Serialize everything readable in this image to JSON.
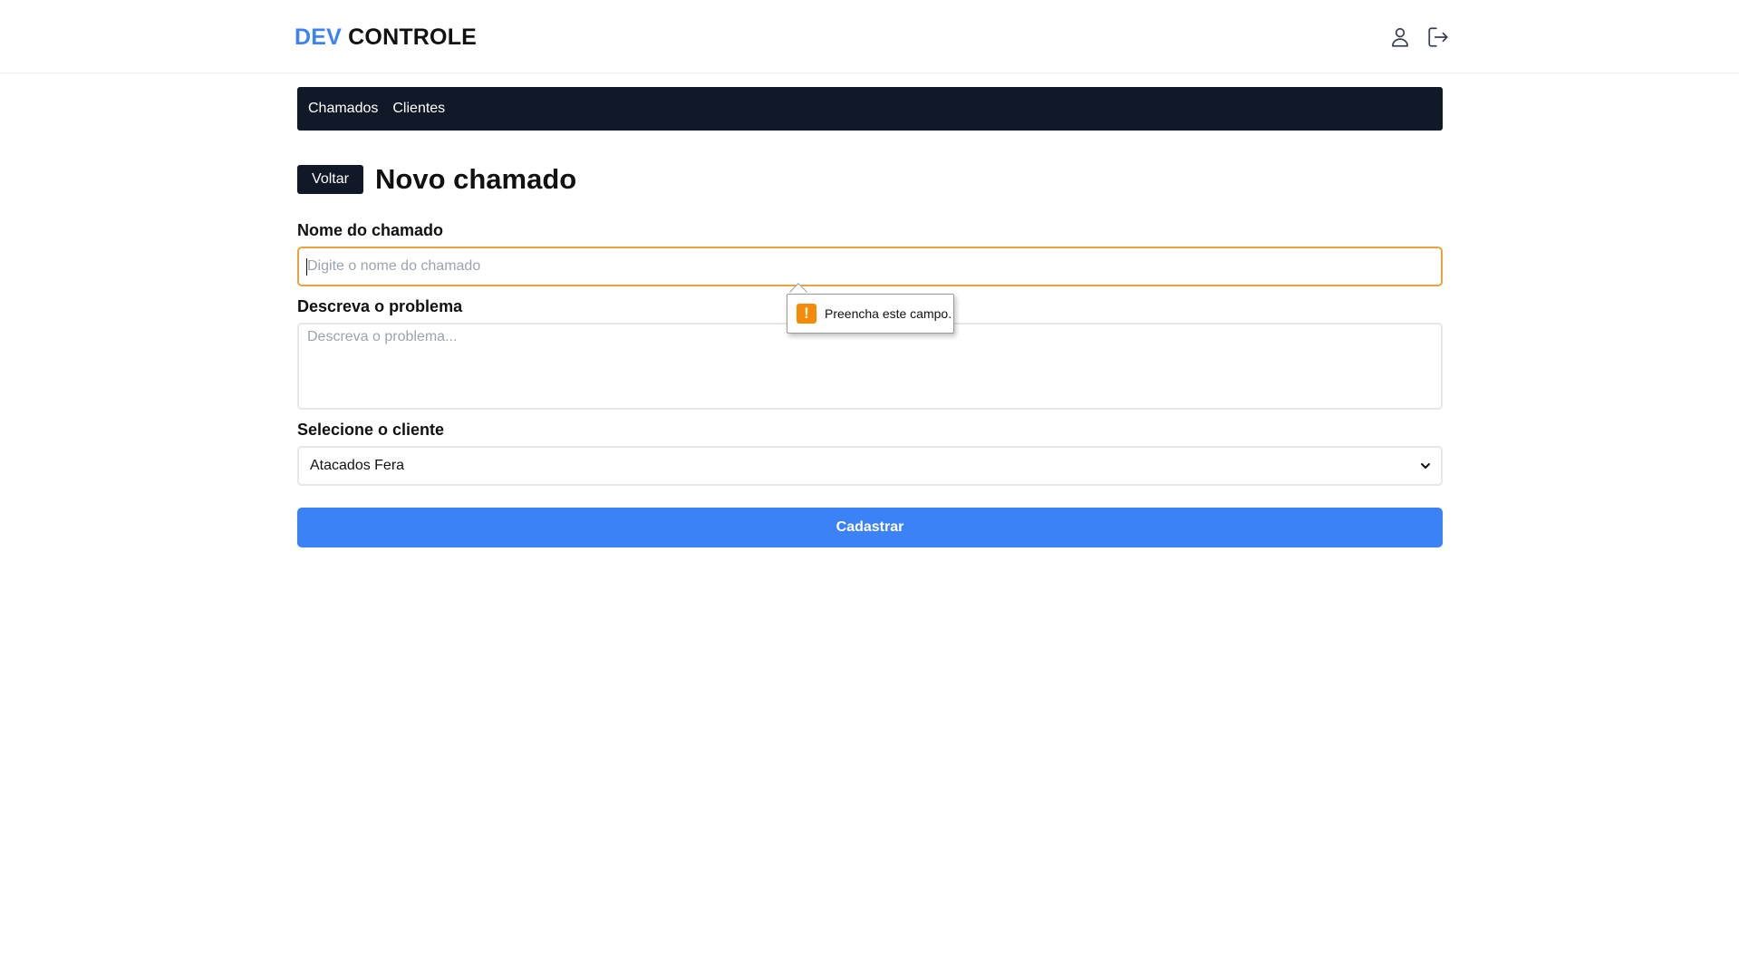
{
  "header": {
    "brand_highlight": "DEV",
    "brand_rest": "CONTROLE",
    "user_icon": "user-icon",
    "logout_icon": "logout-icon"
  },
  "nav": {
    "items": [
      {
        "label": "Chamados"
      },
      {
        "label": "Clientes"
      }
    ]
  },
  "page": {
    "back_label": "Voltar",
    "title": "Novo chamado"
  },
  "form": {
    "name_label": "Nome do chamado",
    "name_placeholder": "Digite o nome do chamado",
    "name_value": "",
    "desc_label": "Descreva o problema",
    "desc_placeholder": "Descreva o problema...",
    "desc_value": "",
    "client_label": "Selecione o cliente",
    "client_selected": "Atacados Fera",
    "submit_label": "Cadastrar"
  },
  "validation": {
    "icon": "!",
    "message": "Preencha este campo."
  },
  "colors": {
    "accent": "#3b82f6",
    "nav_bg": "#111827",
    "focus_border": "#e8a33d",
    "warning": "#f58a07"
  }
}
